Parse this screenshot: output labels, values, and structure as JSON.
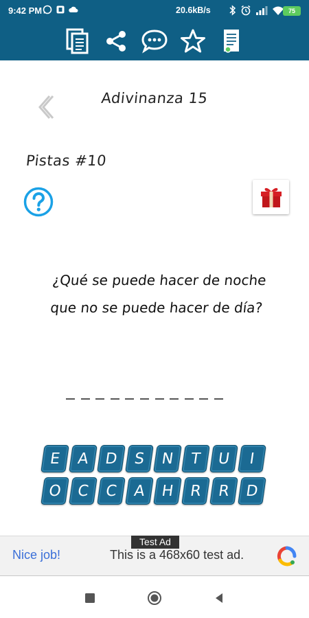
{
  "status_bar": {
    "time": "9:42 PM",
    "network_speed": "20.6kB/s",
    "battery": "75",
    "left_icons": [
      "whatsapp-icon",
      "app-notification-icon",
      "cloud-icon"
    ],
    "right_icons": [
      "bluetooth-icon",
      "alarm-icon",
      "signal-icon",
      "wifi-icon",
      "battery-icon"
    ]
  },
  "toolbar": {
    "background": "#0f5f85",
    "buttons": [
      "copy-icon",
      "share-icon",
      "chat-icon",
      "star-icon",
      "document-icon"
    ]
  },
  "header": {
    "title": "Adivinanza 15",
    "back": "chevron-left-icon"
  },
  "hints": {
    "label": "Pistas #10",
    "help_icon": "question-circle-icon",
    "gift_icon": "gift-icon"
  },
  "riddle": {
    "line1": "¿Qué se puede hacer de noche",
    "line2": "que no se puede hacer de día?"
  },
  "answer": {
    "blank_count": 11
  },
  "keyboard": {
    "row1": [
      "E",
      "A",
      "D",
      "S",
      "N",
      "T",
      "U",
      "I"
    ],
    "row2": [
      "O",
      "C",
      "C",
      "A",
      "H",
      "R",
      "R",
      "D"
    ],
    "key_color": "#1b6a93"
  },
  "ad": {
    "tag": "Test Ad",
    "left_text": "Nice job!",
    "main_text": "This is a 468x60 test ad.",
    "logo": "admob-logo-icon"
  },
  "nav_bar": {
    "buttons": [
      "recents-square-icon",
      "home-circle-icon",
      "back-triangle-icon"
    ]
  }
}
